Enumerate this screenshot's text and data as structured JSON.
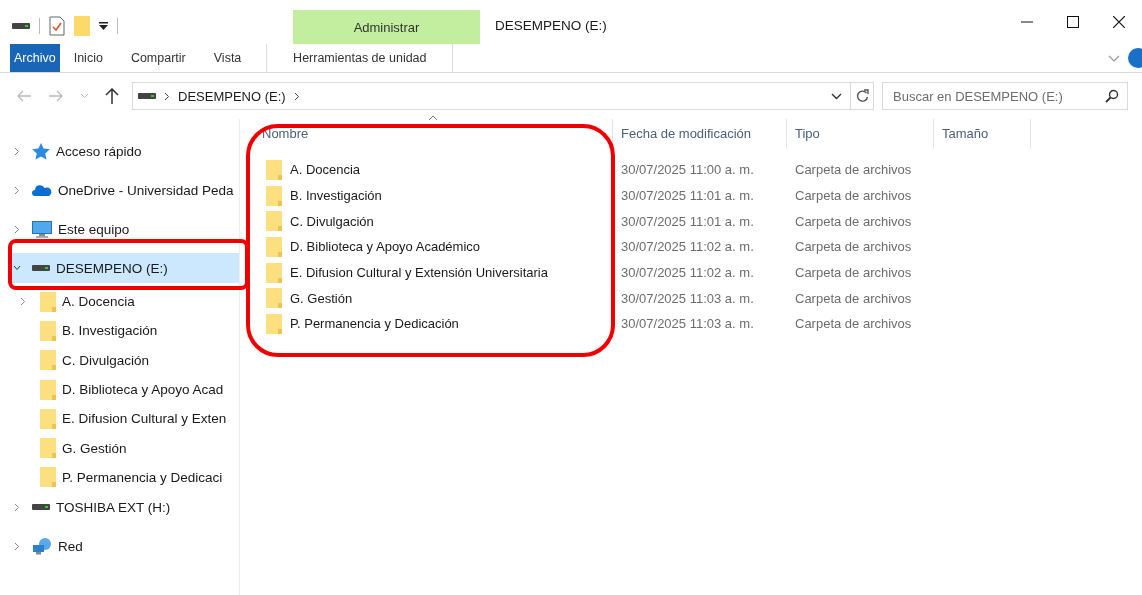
{
  "window": {
    "title": "DESEMPENO (E:)"
  },
  "ribbon": {
    "context_group": "Administrar",
    "tabs": [
      {
        "label": "Archivo",
        "kind": "file",
        "selected": false
      },
      {
        "label": "Inicio",
        "kind": "tab",
        "selected": false
      },
      {
        "label": "Compartir",
        "kind": "tab",
        "selected": false
      },
      {
        "label": "Vista",
        "kind": "tab",
        "selected": false
      },
      {
        "label": "Herramientas de unidad",
        "kind": "context",
        "selected": false
      }
    ]
  },
  "address": {
    "path": [
      "DESEMPENO (E:)"
    ],
    "search_placeholder": "Buscar en DESEMPENO (E:)"
  },
  "navigation": [
    {
      "label": "Acceso rápido",
      "kind": "star",
      "expanded": false,
      "selected": false
    },
    {
      "label": "OneDrive - Universidad Peda",
      "kind": "cloud",
      "expanded": false,
      "selected": false
    },
    {
      "label": "Este equipo",
      "kind": "pc",
      "expanded": false,
      "selected": false
    },
    {
      "label": "DESEMPENO (E:)",
      "kind": "drive",
      "expanded": true,
      "selected": true,
      "children": [
        {
          "label": "A. Docencia",
          "expandable": true
        },
        {
          "label": "B. Investigación",
          "expandable": false
        },
        {
          "label": "C. Divulgación",
          "expandable": false
        },
        {
          "label": "D. Biblioteca y Apoyo Acad",
          "expandable": false
        },
        {
          "label": "E. Difusion Cultural y Exten",
          "expandable": false
        },
        {
          "label": "G. Gestión",
          "expandable": false
        },
        {
          "label": "P. Permanencia y Dedicaci",
          "expandable": false
        }
      ]
    },
    {
      "label": "TOSHIBA EXT (H:)",
      "kind": "drive",
      "expanded": false,
      "selected": false
    },
    {
      "label": "Red",
      "kind": "network",
      "expanded": false,
      "selected": false
    }
  ],
  "columns": [
    "Nombre",
    "Fecha de modificación",
    "Tipo",
    "Tamaño"
  ],
  "rows": [
    {
      "name": "A. Docencia",
      "modified": "30/07/2025 11:00 a. m.",
      "type": "Carpeta de archivos"
    },
    {
      "name": "B. Investigación",
      "modified": "30/07/2025 11:01 a. m.",
      "type": "Carpeta de archivos"
    },
    {
      "name": "C. Divulgación",
      "modified": "30/07/2025 11:01 a. m.",
      "type": "Carpeta de archivos"
    },
    {
      "name": "D. Biblioteca y Apoyo Académico",
      "modified": "30/07/2025 11:02 a. m.",
      "type": "Carpeta de archivos"
    },
    {
      "name": "E. Difusion Cultural y Extensión Universitaria",
      "modified": "30/07/2025 11:02 a. m.",
      "type": "Carpeta de archivos"
    },
    {
      "name": "G. Gestión",
      "modified": "30/07/2025 11:03 a. m.",
      "type": "Carpeta de archivos"
    },
    {
      "name": "P. Permanencia y Dedicación",
      "modified": "30/07/2025 11:03 a. m.",
      "type": "Carpeta de archivos"
    }
  ]
}
